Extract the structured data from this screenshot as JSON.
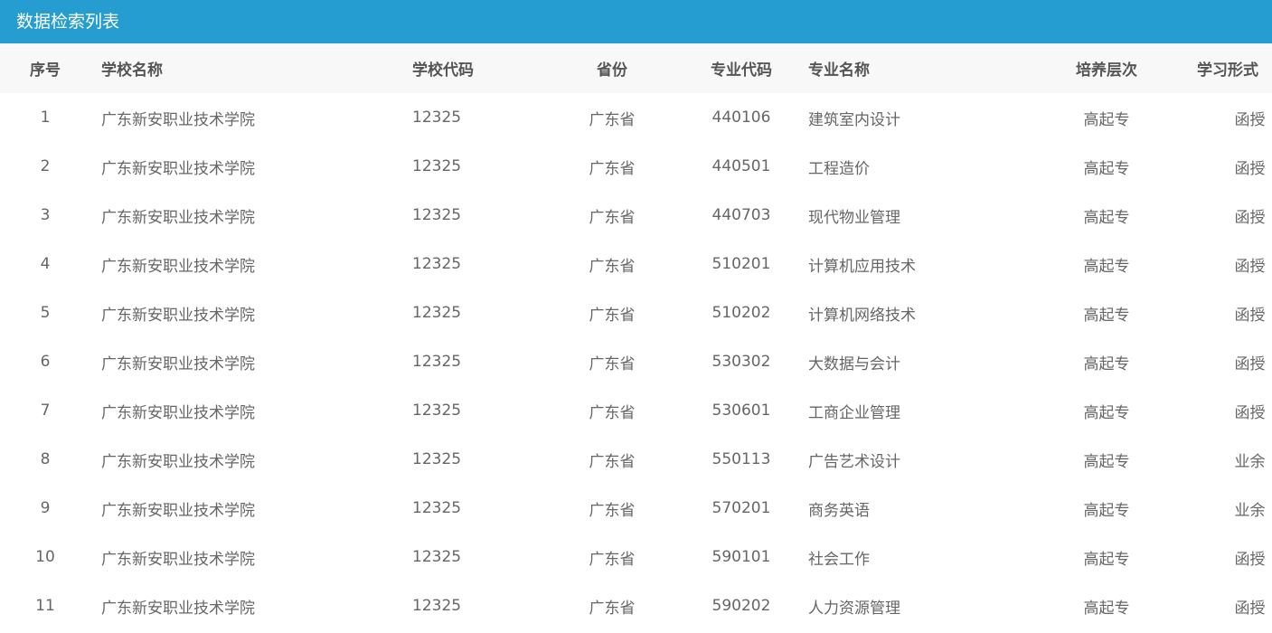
{
  "title": "数据检索列表",
  "colors": {
    "title_bar": "#269dd1",
    "header_bg": "#f8f8f8",
    "header_text": "#555555",
    "cell_text": "#666666"
  },
  "table": {
    "headers": [
      "序号",
      "学校名称",
      "学校代码",
      "省份",
      "专业代码",
      "专业名称",
      "培养层次",
      "学习形式"
    ],
    "rows": [
      [
        "1",
        "广东新安职业技术学院",
        "12325",
        "广东省",
        "440106",
        "建筑室内设计",
        "高起专",
        "函授"
      ],
      [
        "2",
        "广东新安职业技术学院",
        "12325",
        "广东省",
        "440501",
        "工程造价",
        "高起专",
        "函授"
      ],
      [
        "3",
        "广东新安职业技术学院",
        "12325",
        "广东省",
        "440703",
        "现代物业管理",
        "高起专",
        "函授"
      ],
      [
        "4",
        "广东新安职业技术学院",
        "12325",
        "广东省",
        "510201",
        "计算机应用技术",
        "高起专",
        "函授"
      ],
      [
        "5",
        "广东新安职业技术学院",
        "12325",
        "广东省",
        "510202",
        "计算机网络技术",
        "高起专",
        "函授"
      ],
      [
        "6",
        "广东新安职业技术学院",
        "12325",
        "广东省",
        "530302",
        "大数据与会计",
        "高起专",
        "函授"
      ],
      [
        "7",
        "广东新安职业技术学院",
        "12325",
        "广东省",
        "530601",
        "工商企业管理",
        "高起专",
        "函授"
      ],
      [
        "8",
        "广东新安职业技术学院",
        "12325",
        "广东省",
        "550113",
        "广告艺术设计",
        "高起专",
        "业余"
      ],
      [
        "9",
        "广东新安职业技术学院",
        "12325",
        "广东省",
        "570201",
        "商务英语",
        "高起专",
        "业余"
      ],
      [
        "10",
        "广东新安职业技术学院",
        "12325",
        "广东省",
        "590101",
        "社会工作",
        "高起专",
        "函授"
      ],
      [
        "11",
        "广东新安职业技术学院",
        "12325",
        "广东省",
        "590202",
        "人力资源管理",
        "高起专",
        "函授"
      ]
    ]
  }
}
